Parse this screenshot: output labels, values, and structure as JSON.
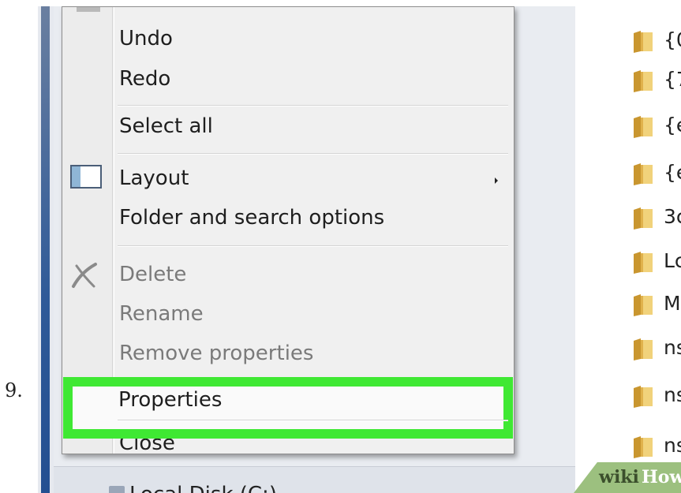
{
  "step": {
    "number": "9."
  },
  "menu": {
    "items": [
      {
        "label": "Undo",
        "enabled": true
      },
      {
        "label": "Redo",
        "enabled": true
      },
      {
        "label": "Select all",
        "enabled": true
      },
      {
        "label": "Layout",
        "enabled": true,
        "has_submenu": true
      },
      {
        "label": "Folder and search options",
        "enabled": true
      },
      {
        "label": "Delete",
        "enabled": false
      },
      {
        "label": "Rename",
        "enabled": false
      },
      {
        "label": "Remove properties",
        "enabled": false
      },
      {
        "label": "Properties",
        "enabled": true,
        "highlighted": true
      },
      {
        "label": "Close",
        "enabled": true
      }
    ],
    "icons": {
      "layout": "layout-pane-icon",
      "delete": "delete-x-icon"
    },
    "highlight_color": "#3fe833"
  },
  "files": [
    {
      "name": "{0"
    },
    {
      "name": "{7"
    },
    {
      "name": "{e"
    },
    {
      "name": "{e"
    },
    {
      "name": "3c"
    },
    {
      "name": "Lc"
    },
    {
      "name": "M"
    },
    {
      "name": "ns"
    },
    {
      "name": "ns"
    },
    {
      "name": "ns"
    }
  ],
  "navigation": {
    "local_disk": "Local Disk (C:)"
  },
  "watermark": {
    "wiki": "wiki",
    "how": "How"
  },
  "colors": {
    "folder": "#e2b64f",
    "nav_bar": "#2f5a98"
  }
}
